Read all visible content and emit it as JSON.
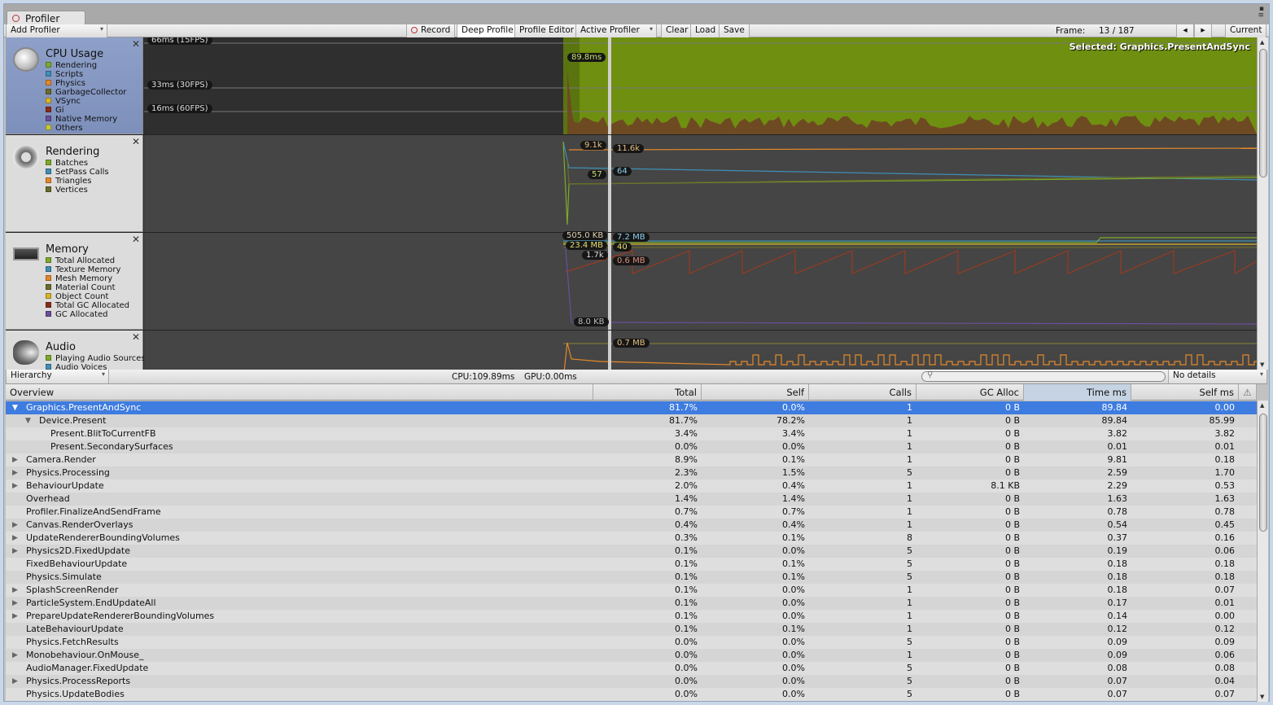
{
  "window": {
    "tab": "Profiler"
  },
  "toolbar": {
    "add_profiler": "Add Profiler",
    "record": "Record",
    "deep_profile": "Deep Profile",
    "profile_editor": "Profile Editor",
    "active_profiler": "Active Profiler",
    "clear": "Clear",
    "load": "Load",
    "save": "Save",
    "frame_label": "Frame:",
    "frame_value": "13 / 187",
    "current": "Current"
  },
  "modules": [
    {
      "title": "CPU Usage",
      "legend": [
        {
          "label": "Rendering",
          "color": "#7cab2a"
        },
        {
          "label": "Scripts",
          "color": "#3f8fb4"
        },
        {
          "label": "Physics",
          "color": "#e3892a"
        },
        {
          "label": "GarbageCollector",
          "color": "#6b6b2a"
        },
        {
          "label": "VSync",
          "color": "#d8b42a"
        },
        {
          "label": "Gi",
          "color": "#8a2c1a"
        },
        {
          "label": "Native Memory",
          "color": "#6a4f9a"
        },
        {
          "label": "Others",
          "color": "#c8c83a"
        }
      ],
      "labels": [
        "66ms (15FPS)",
        "33ms (30FPS)",
        "16ms (60FPS)",
        "89.8ms"
      ],
      "selected": "Selected: Graphics.PresentAndSync"
    },
    {
      "title": "Rendering",
      "legend": [
        {
          "label": "Batches",
          "color": "#7cab2a"
        },
        {
          "label": "SetPass Calls",
          "color": "#3f8fb4"
        },
        {
          "label": "Triangles",
          "color": "#e3892a"
        },
        {
          "label": "Vertices",
          "color": "#6b6b2a"
        }
      ],
      "labels": [
        "9.1k",
        "57",
        "11.6k",
        "64"
      ]
    },
    {
      "title": "Memory",
      "legend": [
        {
          "label": "Total Allocated",
          "color": "#7cab2a"
        },
        {
          "label": "Texture Memory",
          "color": "#3f8fb4"
        },
        {
          "label": "Mesh Memory",
          "color": "#e3892a"
        },
        {
          "label": "Material Count",
          "color": "#6b6b2a"
        },
        {
          "label": "Object Count",
          "color": "#d8b42a"
        },
        {
          "label": "Total GC Allocated",
          "color": "#8a2c1a"
        },
        {
          "label": "GC Allocated",
          "color": "#6a4f9a"
        }
      ],
      "labels": [
        "505.0 KB",
        "23.4 MB",
        "1.7k",
        "8.0 KB",
        "7.2 MB",
        "40",
        "0.6 MB"
      ]
    },
    {
      "title": "Audio",
      "legend": [
        {
          "label": "Playing Audio Sources",
          "color": "#7cab2a"
        },
        {
          "label": "Audio Voices",
          "color": "#3f8fb4"
        }
      ],
      "labels": [
        "0.7 MB"
      ]
    }
  ],
  "hierarchy": {
    "view": "Hierarchy",
    "cpu": "CPU:109.89ms",
    "gpu": "GPU:0.00ms",
    "search_placeholder": "",
    "details": "No details",
    "columns": [
      "Overview",
      "Total",
      "Self",
      "Calls",
      "GC Alloc",
      "Time ms",
      "Self ms"
    ],
    "sorted_column": "Time ms",
    "rows": [
      {
        "name": "Graphics.PresentAndSync",
        "depth": 0,
        "expand": "open",
        "total": "81.7%",
        "self": "0.0%",
        "calls": "1",
        "gc": "0 B",
        "time": "89.84",
        "selfms": "0.00",
        "selected": true
      },
      {
        "name": "Device.Present",
        "depth": 1,
        "expand": "open",
        "total": "81.7%",
        "self": "78.2%",
        "calls": "1",
        "gc": "0 B",
        "time": "89.84",
        "selfms": "85.99"
      },
      {
        "name": "Present.BlitToCurrentFB",
        "depth": 2,
        "expand": "",
        "total": "3.4%",
        "self": "3.4%",
        "calls": "1",
        "gc": "0 B",
        "time": "3.82",
        "selfms": "3.82"
      },
      {
        "name": "Present.SecondarySurfaces",
        "depth": 2,
        "expand": "",
        "total": "0.0%",
        "self": "0.0%",
        "calls": "1",
        "gc": "0 B",
        "time": "0.01",
        "selfms": "0.01"
      },
      {
        "name": "Camera.Render",
        "depth": 0,
        "expand": "closed",
        "total": "8.9%",
        "self": "0.1%",
        "calls": "1",
        "gc": "0 B",
        "time": "9.81",
        "selfms": "0.18"
      },
      {
        "name": "Physics.Processing",
        "depth": 0,
        "expand": "closed",
        "total": "2.3%",
        "self": "1.5%",
        "calls": "5",
        "gc": "0 B",
        "time": "2.59",
        "selfms": "1.70"
      },
      {
        "name": "BehaviourUpdate",
        "depth": 0,
        "expand": "closed",
        "total": "2.0%",
        "self": "0.4%",
        "calls": "1",
        "gc": "8.1 KB",
        "time": "2.29",
        "selfms": "0.53"
      },
      {
        "name": "Overhead",
        "depth": 0,
        "expand": "",
        "total": "1.4%",
        "self": "1.4%",
        "calls": "1",
        "gc": "0 B",
        "time": "1.63",
        "selfms": "1.63"
      },
      {
        "name": "Profiler.FinalizeAndSendFrame",
        "depth": 0,
        "expand": "",
        "total": "0.7%",
        "self": "0.7%",
        "calls": "1",
        "gc": "0 B",
        "time": "0.78",
        "selfms": "0.78"
      },
      {
        "name": "Canvas.RenderOverlays",
        "depth": 0,
        "expand": "closed",
        "total": "0.4%",
        "self": "0.4%",
        "calls": "1",
        "gc": "0 B",
        "time": "0.54",
        "selfms": "0.45"
      },
      {
        "name": "UpdateRendererBoundingVolumes",
        "depth": 0,
        "expand": "closed",
        "total": "0.3%",
        "self": "0.1%",
        "calls": "8",
        "gc": "0 B",
        "time": "0.37",
        "selfms": "0.16"
      },
      {
        "name": "Physics2D.FixedUpdate",
        "depth": 0,
        "expand": "closed",
        "total": "0.1%",
        "self": "0.0%",
        "calls": "5",
        "gc": "0 B",
        "time": "0.19",
        "selfms": "0.06"
      },
      {
        "name": "FixedBehaviourUpdate",
        "depth": 0,
        "expand": "",
        "total": "0.1%",
        "self": "0.1%",
        "calls": "5",
        "gc": "0 B",
        "time": "0.18",
        "selfms": "0.18"
      },
      {
        "name": "Physics.Simulate",
        "depth": 0,
        "expand": "",
        "total": "0.1%",
        "self": "0.1%",
        "calls": "5",
        "gc": "0 B",
        "time": "0.18",
        "selfms": "0.18"
      },
      {
        "name": "SplashScreenRender",
        "depth": 0,
        "expand": "closed",
        "total": "0.1%",
        "self": "0.0%",
        "calls": "1",
        "gc": "0 B",
        "time": "0.18",
        "selfms": "0.07"
      },
      {
        "name": "ParticleSystem.EndUpdateAll",
        "depth": 0,
        "expand": "closed",
        "total": "0.1%",
        "self": "0.0%",
        "calls": "1",
        "gc": "0 B",
        "time": "0.17",
        "selfms": "0.01"
      },
      {
        "name": "PrepareUpdateRendererBoundingVolumes",
        "depth": 0,
        "expand": "closed",
        "total": "0.1%",
        "self": "0.0%",
        "calls": "1",
        "gc": "0 B",
        "time": "0.14",
        "selfms": "0.00"
      },
      {
        "name": "LateBehaviourUpdate",
        "depth": 0,
        "expand": "",
        "total": "0.1%",
        "self": "0.1%",
        "calls": "1",
        "gc": "0 B",
        "time": "0.12",
        "selfms": "0.12"
      },
      {
        "name": "Physics.FetchResults",
        "depth": 0,
        "expand": "",
        "total": "0.0%",
        "self": "0.0%",
        "calls": "5",
        "gc": "0 B",
        "time": "0.09",
        "selfms": "0.09"
      },
      {
        "name": "Monobehaviour.OnMouse_",
        "depth": 0,
        "expand": "closed",
        "total": "0.0%",
        "self": "0.0%",
        "calls": "1",
        "gc": "0 B",
        "time": "0.09",
        "selfms": "0.06"
      },
      {
        "name": "AudioManager.FixedUpdate",
        "depth": 0,
        "expand": "",
        "total": "0.0%",
        "self": "0.0%",
        "calls": "5",
        "gc": "0 B",
        "time": "0.08",
        "selfms": "0.08"
      },
      {
        "name": "Physics.ProcessReports",
        "depth": 0,
        "expand": "closed",
        "total": "0.0%",
        "self": "0.0%",
        "calls": "5",
        "gc": "0 B",
        "time": "0.07",
        "selfms": "0.04"
      },
      {
        "name": "Physics.UpdateBodies",
        "depth": 0,
        "expand": "",
        "total": "0.0%",
        "self": "0.0%",
        "calls": "5",
        "gc": "0 B",
        "time": "0.07",
        "selfms": "0.07"
      }
    ]
  }
}
